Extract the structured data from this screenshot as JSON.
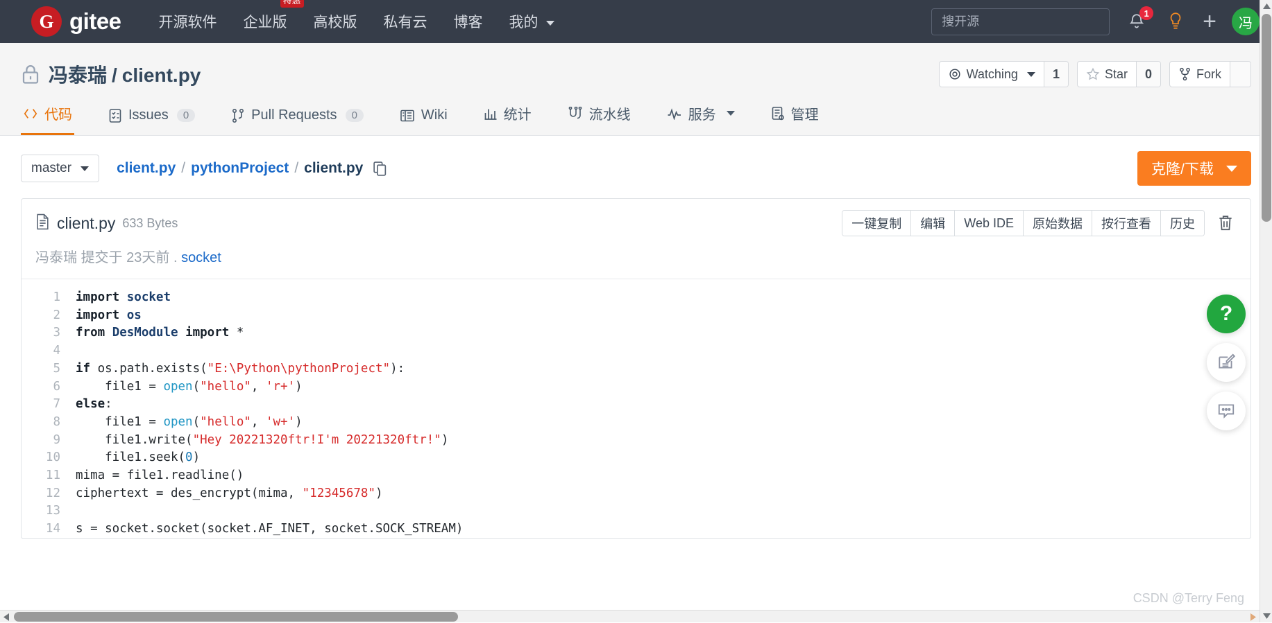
{
  "navbar": {
    "logo_letter": "G",
    "brand": "gitee",
    "links": [
      {
        "label": "开源软件",
        "badge": null
      },
      {
        "label": "企业版",
        "badge": "特惠"
      },
      {
        "label": "高校版",
        "badge": null
      },
      {
        "label": "私有云",
        "badge": null
      },
      {
        "label": "博客",
        "badge": null
      },
      {
        "label": "我的",
        "badge": null,
        "has_caret": true
      }
    ],
    "search_placeholder": "搜开源",
    "search_value": "",
    "notification_count": "1",
    "avatar_letter": "冯",
    "icons": {
      "bell": "bell-icon",
      "bulb": "lightbulb-icon",
      "plus": "plus-icon"
    }
  },
  "repo": {
    "owner": "冯泰瑞",
    "separator": "/",
    "name": "client.py",
    "visibility": "private",
    "watching_label": "Watching",
    "watching_count": "1",
    "star_label": "Star",
    "star_count": "0",
    "fork_label": "Fork",
    "tabs": [
      {
        "label": "代码",
        "icon": "code-icon",
        "count": null,
        "active": true
      },
      {
        "label": "Issues",
        "icon": "issue-icon",
        "count": "0",
        "active": false
      },
      {
        "label": "Pull Requests",
        "icon": "pull-request-icon",
        "count": "0",
        "active": false
      },
      {
        "label": "Wiki",
        "icon": "wiki-icon",
        "count": null,
        "active": false
      },
      {
        "label": "统计",
        "icon": "chart-icon",
        "count": null,
        "active": false
      },
      {
        "label": "流水线",
        "icon": "pipeline-icon",
        "count": null,
        "active": false
      },
      {
        "label": "服务",
        "icon": "service-icon",
        "count": null,
        "active": false,
        "has_caret": true
      },
      {
        "label": "管理",
        "icon": "manage-icon",
        "count": null,
        "active": false
      }
    ]
  },
  "crumbbar": {
    "branch": "master",
    "crumbs": [
      {
        "label": "client.py",
        "link": true
      },
      {
        "label": "pythonProject",
        "link": true
      },
      {
        "label": "client.py",
        "link": false
      }
    ],
    "separator": "/",
    "copy_icon": "copy-icon",
    "clone_label": "克隆/下载"
  },
  "file": {
    "icon": "file-icon",
    "name": "client.py",
    "size": "633 Bytes",
    "tools": [
      "一键复制",
      "编辑",
      "Web IDE",
      "原始数据",
      "按行查看",
      "历史"
    ],
    "delete_icon": "trash-icon",
    "commit_author": "冯泰瑞",
    "commit_prefix": "提交于",
    "commit_time": "23天前",
    "commit_dot": ".",
    "commit_message": "socket"
  },
  "code": {
    "lines": [
      {
        "n": "1",
        "tokens": [
          {
            "t": "import ",
            "c": "k"
          },
          {
            "t": "socket",
            "c": "mod"
          }
        ]
      },
      {
        "n": "2",
        "tokens": [
          {
            "t": "import ",
            "c": "k"
          },
          {
            "t": "os",
            "c": "mod"
          }
        ]
      },
      {
        "n": "3",
        "tokens": [
          {
            "t": "from ",
            "c": "k"
          },
          {
            "t": "DesModule",
            "c": "mod"
          },
          {
            "t": " ",
            "c": "lc"
          },
          {
            "t": "import",
            "c": "k"
          },
          {
            "t": " *",
            "c": "lc"
          }
        ]
      },
      {
        "n": "4",
        "tokens": []
      },
      {
        "n": "5",
        "tokens": [
          {
            "t": "if",
            "c": "k"
          },
          {
            "t": " os.path.exists(",
            "c": "lc"
          },
          {
            "t": "\"E:\\Python\\pythonProject\"",
            "c": "st"
          },
          {
            "t": "):",
            "c": "lc"
          }
        ]
      },
      {
        "n": "6",
        "tokens": [
          {
            "t": "    file1 = ",
            "c": "lc"
          },
          {
            "t": "open",
            "c": "fn"
          },
          {
            "t": "(",
            "c": "lc"
          },
          {
            "t": "\"hello\"",
            "c": "st"
          },
          {
            "t": ", ",
            "c": "lc"
          },
          {
            "t": "'r+'",
            "c": "st"
          },
          {
            "t": ")",
            "c": "lc"
          }
        ]
      },
      {
        "n": "7",
        "tokens": [
          {
            "t": "else",
            "c": "k"
          },
          {
            "t": ":",
            "c": "lc"
          }
        ]
      },
      {
        "n": "8",
        "tokens": [
          {
            "t": "    file1 = ",
            "c": "lc"
          },
          {
            "t": "open",
            "c": "fn"
          },
          {
            "t": "(",
            "c": "lc"
          },
          {
            "t": "\"hello\"",
            "c": "st"
          },
          {
            "t": ", ",
            "c": "lc"
          },
          {
            "t": "'w+'",
            "c": "st"
          },
          {
            "t": ")",
            "c": "lc"
          }
        ]
      },
      {
        "n": "9",
        "tokens": [
          {
            "t": "    file1.write(",
            "c": "lc"
          },
          {
            "t": "\"Hey 20221320ftr!I'm 20221320ftr!\"",
            "c": "st"
          },
          {
            "t": ")",
            "c": "lc"
          }
        ]
      },
      {
        "n": "10",
        "tokens": [
          {
            "t": "    file1.seek(",
            "c": "lc"
          },
          {
            "t": "0",
            "c": "num"
          },
          {
            "t": ")",
            "c": "lc"
          }
        ]
      },
      {
        "n": "11",
        "tokens": [
          {
            "t": "mima = file1.readline()",
            "c": "lc"
          }
        ]
      },
      {
        "n": "12",
        "tokens": [
          {
            "t": "ciphertext = des_encrypt(mima, ",
            "c": "lc"
          },
          {
            "t": "\"12345678\"",
            "c": "st"
          },
          {
            "t": ")",
            "c": "lc"
          }
        ]
      },
      {
        "n": "13",
        "tokens": []
      },
      {
        "n": "14",
        "tokens": [
          {
            "t": "s = socket.socket(socket.AF_INET, socket.SOCK_STREAM)",
            "c": "lc"
          }
        ]
      }
    ]
  },
  "floating": {
    "help_label": "?",
    "buttons": [
      "help-button",
      "feedback-button",
      "comment-button"
    ]
  },
  "watermark": "CSDN @Terry Feng",
  "colors": {
    "navbar_bg": "#363d49",
    "accent_orange": "#e8740c",
    "clone_orange": "#fa7d20",
    "link_blue": "#1b6ac9",
    "green": "#22a73f",
    "red": "#c71d23"
  }
}
